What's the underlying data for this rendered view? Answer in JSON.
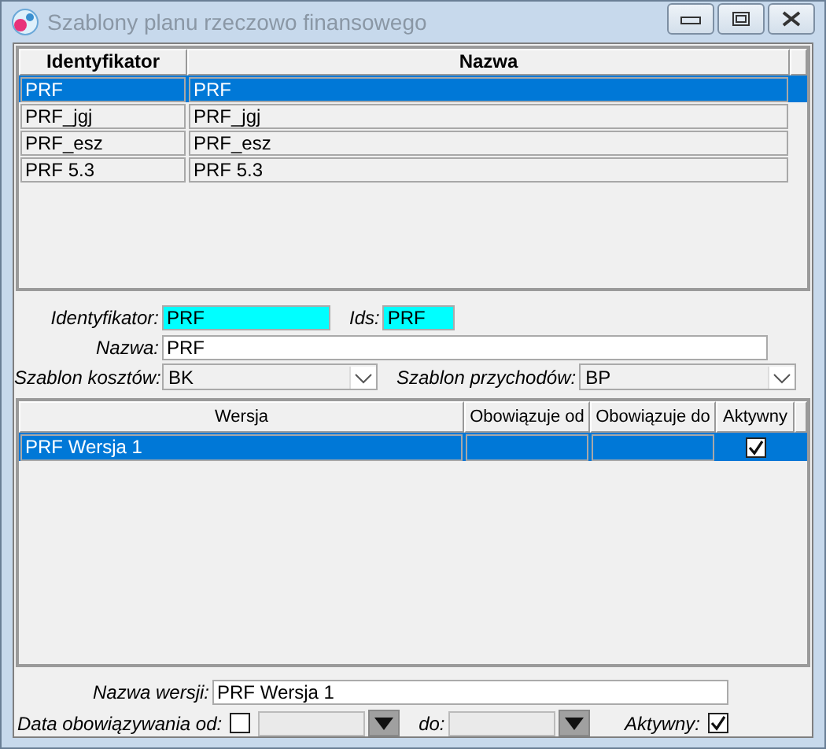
{
  "window": {
    "title": "Szablony planu rzeczowo finansowego"
  },
  "templates": {
    "columns": [
      "Identyfikator",
      "Nazwa"
    ],
    "rows": [
      {
        "cells": [
          "PRF",
          "PRF"
        ],
        "selected": true
      },
      {
        "cells": [
          "PRF_jgj",
          "PRF_jgj"
        ],
        "selected": false
      },
      {
        "cells": [
          "PRF_esz",
          "PRF_esz"
        ],
        "selected": false
      },
      {
        "cells": [
          "PRF 5.3",
          "PRF 5.3"
        ],
        "selected": false
      }
    ]
  },
  "template_form": {
    "identifier_label": "Identyfikator:",
    "identifier": "PRF",
    "ids_label": "Ids:",
    "ids": "PRF",
    "name_label": "Nazwa:",
    "name": "PRF",
    "cost_label": "Szablon kosztów:",
    "cost": "BK",
    "revenue_label": "Szablon przychodów:",
    "revenue": "BP"
  },
  "versions": {
    "columns": [
      "Wersja",
      "Obowiązuje od",
      "Obowiązuje do",
      "Aktywny"
    ],
    "rows": [
      {
        "name": "PRF Wersja 1",
        "active": true,
        "selected": true
      }
    ]
  },
  "version_form": {
    "name_label": "Nazwa wersji:",
    "name": "PRF Wersja 1",
    "from_label": "Data obowiązywania od:",
    "from_checked": false,
    "to_label": "do:",
    "active_label": "Aktywny:",
    "active": true
  }
}
